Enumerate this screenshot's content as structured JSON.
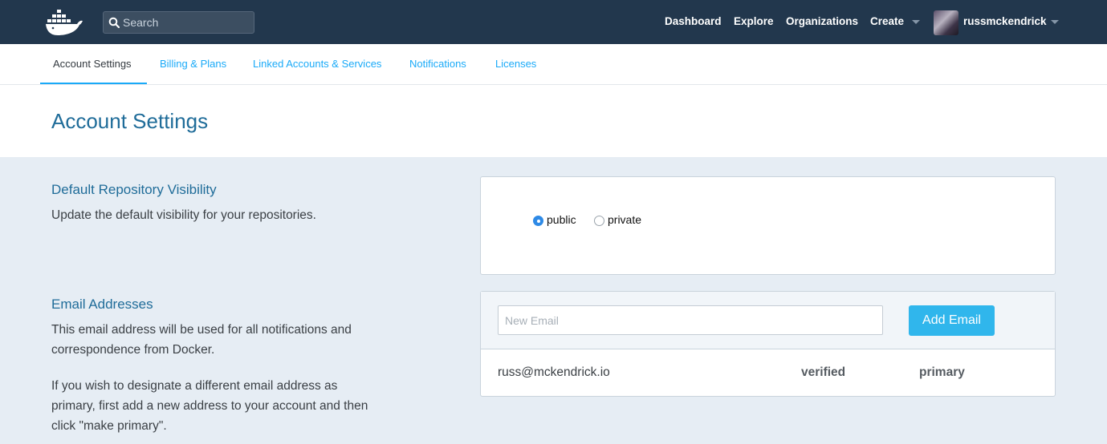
{
  "topnav": {
    "search_placeholder": "Search",
    "links": {
      "dashboard": "Dashboard",
      "explore": "Explore",
      "organizations": "Organizations",
      "create": "Create"
    },
    "username": "russmckendrick"
  },
  "tabs": [
    {
      "label": "Account Settings",
      "active": true
    },
    {
      "label": "Billing & Plans",
      "active": false
    },
    {
      "label": "Linked Accounts & Services",
      "active": false
    },
    {
      "label": "Notifications",
      "active": false
    },
    {
      "label": "Licenses",
      "active": false
    }
  ],
  "page_title": "Account Settings",
  "visibility": {
    "title": "Default Repository Visibility",
    "description": "Update the default visibility for your repositories.",
    "options": [
      {
        "label": "public",
        "selected": true
      },
      {
        "label": "private",
        "selected": false
      }
    ]
  },
  "emails": {
    "title": "Email Addresses",
    "description_1": "This email address will be used for all notifications and correspondence from Docker.",
    "description_2": "If you wish to designate a different email address as primary, first add a new address to your account and then click \"make primary\".",
    "input_placeholder": "New Email",
    "add_button": "Add Email",
    "rows": [
      {
        "address": "russ@mckendrick.io",
        "status": "verified",
        "role": "primary"
      }
    ]
  },
  "colors": {
    "navbar": "#22374d",
    "link": "#1aaaf8",
    "heading": "#1f6c99",
    "button": "#30b6ec",
    "background": "#e6edf4"
  }
}
